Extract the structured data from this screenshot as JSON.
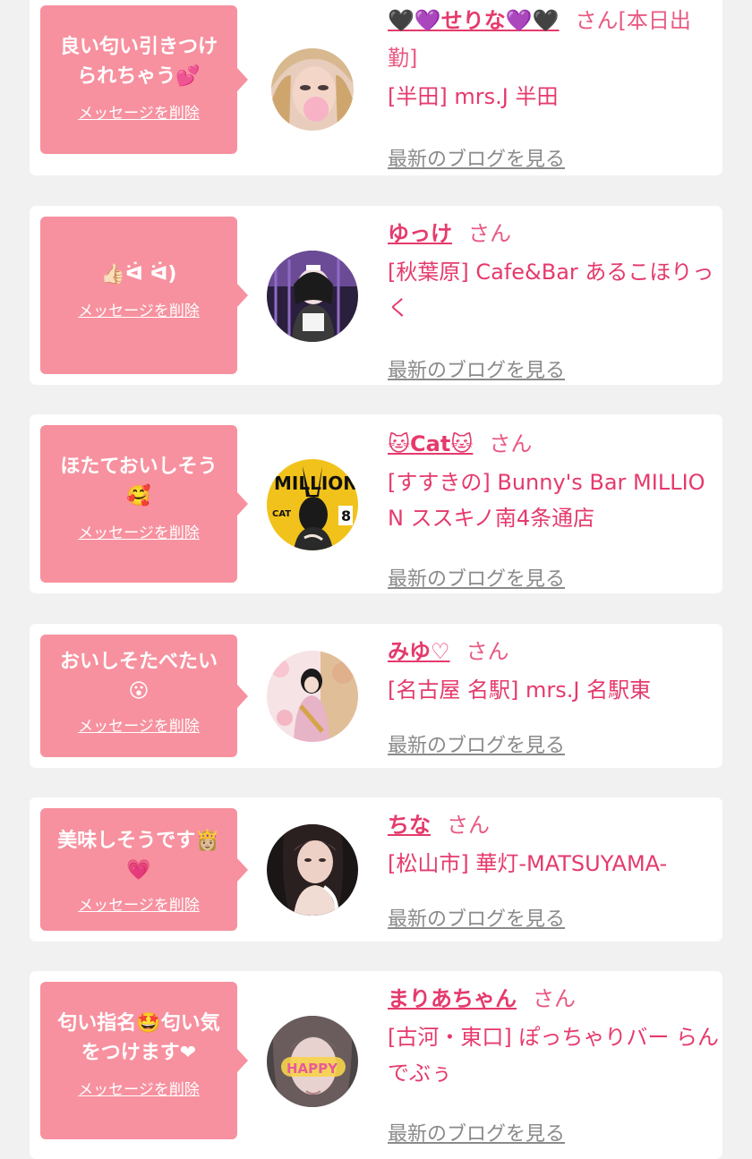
{
  "cards": [
    {
      "message": "良い匂い引きつけられちゃう💕",
      "delete_label": "メッセージを削除",
      "name": "🖤💜せりな💜🖤",
      "honorific": "さん[本日出勤]",
      "shop": "[半田] mrs.J 半田",
      "blog_label": "最新のブログを見る"
    },
    {
      "message": "👍🏻ᐛ ᐛ)",
      "delete_label": "メッセージを削除",
      "name": "ゆっけ",
      "honorific": "さん",
      "shop": "[秋葉原] Cafe&Bar あるこほりっく",
      "blog_label": "最新のブログを見る"
    },
    {
      "message": "ほたておいしそう🥰",
      "delete_label": "メッセージを削除",
      "name": "🐱Cat🐱",
      "honorific": "さん",
      "shop": "[すすきの] Bunny's Bar MILLION ススキノ南4条通店",
      "blog_label": "最新のブログを見る"
    },
    {
      "message": "おいしそたべたい😮",
      "delete_label": "メッセージを削除",
      "name": "みゆ♡",
      "honorific": "さん",
      "shop": "[名古屋 名駅] mrs.J 名駅東",
      "blog_label": "最新のブログを見る"
    },
    {
      "message": "美味しそうです👸🏼💗",
      "delete_label": "メッセージを削除",
      "name": "ちな",
      "honorific": "さん",
      "shop": "[松山市] 華灯-MATSUYAMA-",
      "blog_label": "最新のブログを見る"
    },
    {
      "message": "匂い指名🤩匂い気をつけます❤",
      "delete_label": "メッセージを削除",
      "name": "まりあちゃん",
      "honorific": "さん",
      "shop": "[古河・東口] ぽっちゃりバー らんでぶぅ",
      "blog_label": "最新のブログを見る"
    }
  ],
  "avatar_texts": {
    "cat_magazine_title": "MILLION",
    "cat_magazine_name": "CAT",
    "cat_magazine_number": "8",
    "happy_glasses": "HAPPY"
  },
  "colors": {
    "bubble": "#f7919f",
    "name": "#e53a6c",
    "background": "#f1f1f1",
    "link_gray": "#8a8a8a"
  }
}
